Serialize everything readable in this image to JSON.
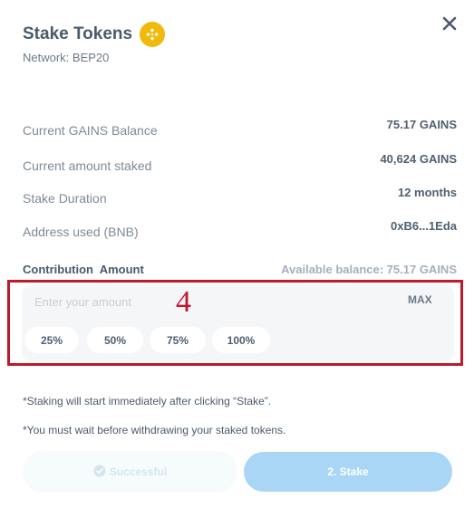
{
  "header": {
    "title": "Stake Tokens",
    "network": "Network: BEP20",
    "token_icon": "bnb-icon",
    "close_icon": "close-icon"
  },
  "details": [
    {
      "label": "Current GAINS Balance",
      "value": "75.17 GAINS"
    },
    {
      "label": "Current amount staked",
      "value": "40,624 GAINS"
    },
    {
      "label": "Stake Duration",
      "value": "12 months"
    },
    {
      "label": "Address used (BNB)",
      "value": "0xB6...1Eda"
    }
  ],
  "contribution": {
    "label": "Contribution  Amount",
    "available": "Available balance: 75.17 GAINS",
    "placeholder": "Enter your amount",
    "value": "",
    "max_label": "MAX",
    "percent_options": [
      "25%",
      "50%",
      "75%",
      "100%"
    ]
  },
  "annotation": {
    "marker": "4",
    "color": "#c0192c"
  },
  "notes": [
    "*Staking will start immediately after clicking “Stake”.",
    "*You must wait before withdrawing your staked tokens."
  ],
  "actions": {
    "step1_label": "Successful",
    "step1_icon": "check-circle-icon",
    "step2_label": "2. Stake"
  },
  "colors": {
    "bnb": "#f0b90b",
    "stake_button": "#a9d6f5",
    "annotation_red": "#c0192c"
  }
}
